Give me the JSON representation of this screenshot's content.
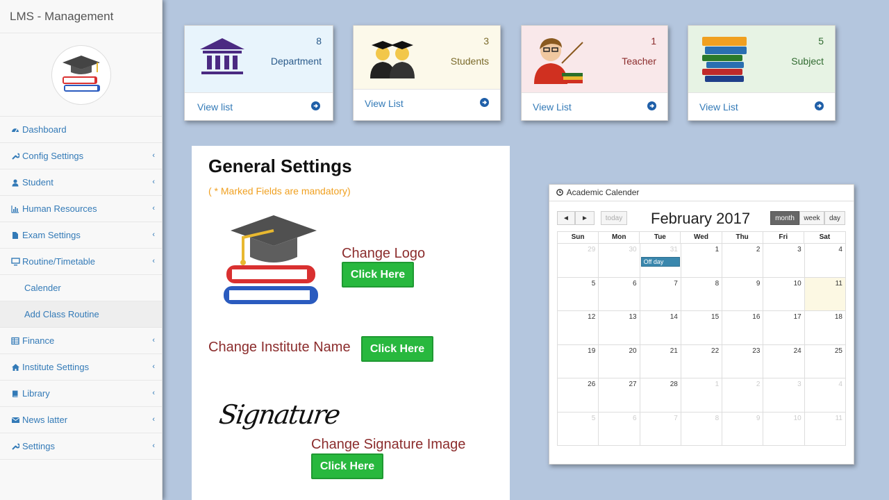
{
  "sidebar": {
    "brand": "LMS - Management",
    "items": [
      {
        "label": "Dashboard",
        "icon": "dashboard-icon",
        "has_chevron": false
      },
      {
        "label": "Config Settings",
        "icon": "wrench-icon",
        "has_chevron": true
      },
      {
        "label": "Student",
        "icon": "user-icon",
        "has_chevron": true
      },
      {
        "label": "Human Resources",
        "icon": "bar-chart-icon",
        "has_chevron": true
      },
      {
        "label": "Exam Settings",
        "icon": "file-icon",
        "has_chevron": true
      },
      {
        "label": "Routine/Timetable",
        "icon": "desktop-icon",
        "has_chevron": true
      },
      {
        "label": "Calender",
        "icon": "",
        "has_chevron": false
      },
      {
        "label": "Add Class Routine",
        "icon": "",
        "has_chevron": false
      },
      {
        "label": "Finance",
        "icon": "table-icon",
        "has_chevron": true
      },
      {
        "label": "Institute Settings",
        "icon": "home-icon",
        "has_chevron": true
      },
      {
        "label": "Library",
        "icon": "book-icon",
        "has_chevron": true
      },
      {
        "label": "News latter",
        "icon": "envelope-icon",
        "has_chevron": true
      },
      {
        "label": "Settings",
        "icon": "wrench-icon",
        "has_chevron": true
      }
    ]
  },
  "cards": [
    {
      "count": "8",
      "label": "Department",
      "link": "View list",
      "bg": "#e8f4fc",
      "label_color": "#2a5a8a"
    },
    {
      "count": "3",
      "label": "Students",
      "link": "View List",
      "bg": "#fcf9ea",
      "label_color": "#7a6a2a"
    },
    {
      "count": "1",
      "label": "Teacher",
      "link": "View List",
      "bg": "#f9e8ea",
      "label_color": "#8b2c2c"
    },
    {
      "count": "5",
      "label": "Subject",
      "link": "View List",
      "bg": "#e7f3e4",
      "label_color": "#2f6a2f"
    }
  ],
  "general_settings": {
    "title": "General Settings",
    "note": "( * Marked Fields are mandatory)",
    "change_logo": "Change Logo",
    "change_name": "Change Institute Name",
    "change_signature": "Change Signature Image",
    "click_here": "Click Here",
    "signature_text": "Signature"
  },
  "calendar": {
    "header": "Academic Calender",
    "title": "February 2017",
    "today_btn": "today",
    "prev": "◄",
    "next": "►",
    "views": [
      "month",
      "week",
      "day"
    ],
    "active_view": "month",
    "dow": [
      "Sun",
      "Mon",
      "Tue",
      "Wed",
      "Thu",
      "Fri",
      "Sat"
    ],
    "weeks": [
      [
        "29",
        "30",
        "31",
        "1",
        "2",
        "3",
        "4"
      ],
      [
        "5",
        "6",
        "7",
        "8",
        "9",
        "10",
        "11"
      ],
      [
        "12",
        "13",
        "14",
        "15",
        "16",
        "17",
        "18"
      ],
      [
        "19",
        "20",
        "21",
        "22",
        "23",
        "24",
        "25"
      ],
      [
        "26",
        "27",
        "28",
        "1",
        "2",
        "3",
        "4"
      ],
      [
        "5",
        "6",
        "7",
        "8",
        "9",
        "10",
        "11"
      ]
    ],
    "event": {
      "label": "Off day",
      "week": 0,
      "day": 2
    },
    "today": {
      "week": 1,
      "day": 6
    }
  }
}
